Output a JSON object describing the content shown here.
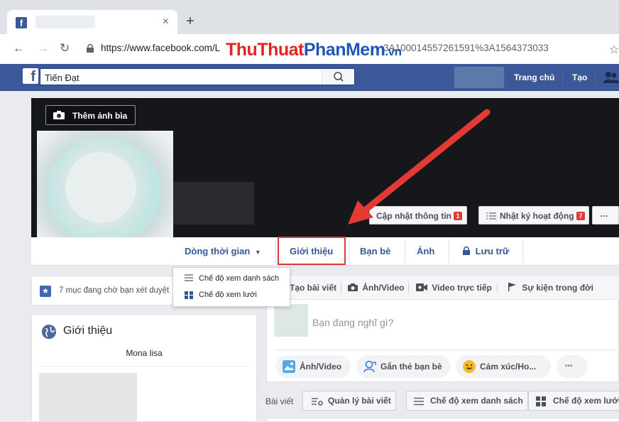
{
  "browser": {
    "tab_close": "×",
    "new_tab": "+",
    "url_host": "https://www.facebook.com/L",
    "url_rest": "3A100014557261591%3A1564373033",
    "watermark": {
      "part1": "ThuThuat",
      "part2": "PhanMem",
      "part3": ".vn"
    }
  },
  "fb": {
    "search_value": "Tiến Đạt",
    "nav": {
      "home": "Trang chủ",
      "create": "Tạo"
    }
  },
  "cover": {
    "add_cover": "Thêm ảnh bìa",
    "update_info": "Cập nhật thông tin",
    "update_badge": "1",
    "activity_log": "Nhật ký hoạt động",
    "activity_badge": "7",
    "more": "···"
  },
  "profile_tabs": {
    "timeline": "Dòng thời gian",
    "about": "Giới thiệu",
    "friends": "Bạn bè",
    "photos": "Ảnh",
    "archive": "Lưu trữ"
  },
  "timeline_dropdown": {
    "list_view": "Chế độ xem danh sách",
    "grid_view": "Chế độ xem lưới"
  },
  "left": {
    "pending_notice": "7 mục đang chờ bạn xét duyệt",
    "intro_title": "Giới thiệu",
    "intro_name": "Mona lisa"
  },
  "composer": {
    "tabs": {
      "create_post": "Tạo bài viết",
      "photo_video": "Ảnh/Video",
      "live_video": "Video trực tiếp",
      "life_event": "Sự kiện trong đời"
    },
    "placeholder": "Bạn đang nghĩ gì?",
    "pills": {
      "photo_video": "Ảnh/Video",
      "tag_friends": "Gắn thẻ bạn bè",
      "feeling": "Cảm xúc/Ho...",
      "more": "•••"
    }
  },
  "posts_bar": {
    "label": "Bài viết",
    "manage": "Quản lý bài viết",
    "list_view": "Chế độ xem danh sách",
    "grid_view": "Chế độ xem lưới"
  },
  "colors": {
    "fb_blue": "#3b5998",
    "highlight": "#e0383a",
    "arrow": "#e53935"
  }
}
